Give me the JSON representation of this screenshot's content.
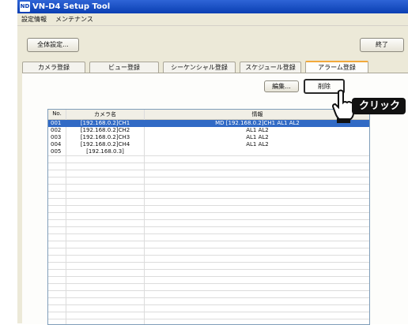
{
  "window": {
    "title": "VN-D4 Setup Tool",
    "icon_label": "ND"
  },
  "menu": [
    "設定情報",
    "メンテナンス"
  ],
  "toolbar": {
    "global_settings": "全体設定...",
    "exit": "終了"
  },
  "tabs": [
    "カメラ登録",
    "ビュー登録",
    "シーケンシャル登録",
    "スケジュール登録",
    "アラーム登録"
  ],
  "active_tab": "アラーム登録",
  "actions": {
    "edit": "編集...",
    "delete": "削除"
  },
  "table": {
    "columns": [
      "No.",
      "カメラ名",
      "情報"
    ],
    "rows": [
      {
        "no": "001",
        "name": "[192.168.0.2]CH1",
        "info": "MD [192.168.0.2]CH1  AL1  AL2",
        "selected": true
      },
      {
        "no": "002",
        "name": "[192.168.0.2]CH2",
        "info": "AL1  AL2",
        "selected": false
      },
      {
        "no": "003",
        "name": "[192.168.0.2]CH3",
        "info": "AL1  AL2",
        "selected": false
      },
      {
        "no": "004",
        "name": "[192.168.0.2]CH4",
        "info": "AL1  AL2",
        "selected": false
      },
      {
        "no": "005",
        "name": "[192.168.0.3]",
        "info": "",
        "selected": false
      }
    ]
  },
  "annotation": {
    "click_label": "クリック"
  },
  "colors": {
    "titlebar": "#0b3fb3",
    "selection": "#316ac5",
    "active_tab_accent": "#f2a93b",
    "callout": "#111111"
  }
}
